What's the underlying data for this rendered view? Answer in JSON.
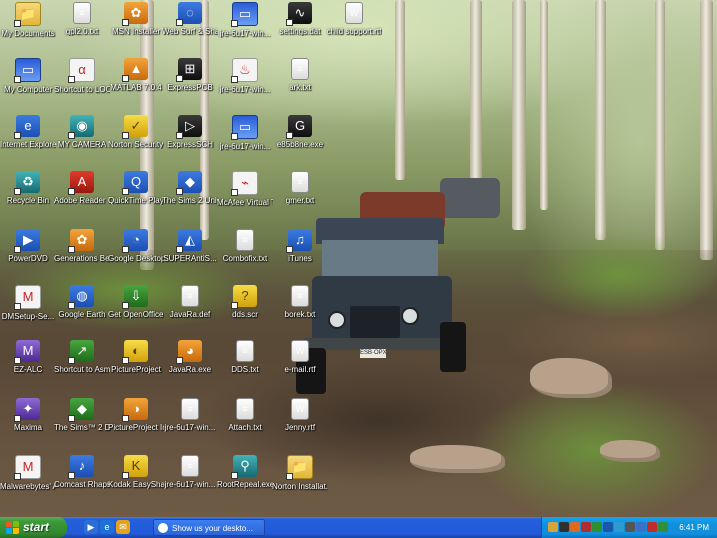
{
  "desktop": {
    "icons": [
      {
        "label": "My Documents",
        "glyph": "📁",
        "cls": "g-folder",
        "col": 0,
        "row": 0
      },
      {
        "label": "My Computer",
        "glyph": "▭",
        "cls": "g-win",
        "col": 0,
        "row": 1
      },
      {
        "label": "Internet Explorer",
        "glyph": "e",
        "cls": "g-blue",
        "col": 0,
        "row": 2
      },
      {
        "label": "Recycle Bin",
        "glyph": "♻",
        "cls": "g-teal",
        "col": 0,
        "row": 3
      },
      {
        "label": "PowerDVD",
        "glyph": "▶",
        "cls": "g-blue",
        "col": 0,
        "row": 4
      },
      {
        "label": "DMSetup-Se...",
        "glyph": "M",
        "cls": "g-white",
        "col": 0,
        "row": 5
      },
      {
        "label": "EZ-ALC",
        "glyph": "M",
        "cls": "g-purple",
        "col": 0,
        "row": 6
      },
      {
        "label": "Maxima",
        "glyph": "✦",
        "cls": "g-purple",
        "col": 0,
        "row": 7
      },
      {
        "label": "Malwarebytes' Anti-Malware",
        "glyph": "M",
        "cls": "g-white",
        "col": 0,
        "row": 8
      },
      {
        "label": "gpl2.0.txt",
        "glyph": "≡",
        "cls": "g-doc",
        "col": 1,
        "row": 0
      },
      {
        "label": "Shortcut to LOOK.EXE",
        "glyph": "α",
        "cls": "g-white",
        "col": 1,
        "row": 1
      },
      {
        "label": "MY CAMERA",
        "glyph": "◉",
        "cls": "g-teal",
        "col": 1,
        "row": 2
      },
      {
        "label": "Adobe Reader 7.0",
        "glyph": "A",
        "cls": "g-red",
        "col": 1,
        "row": 3
      },
      {
        "label": "Generations Beginner's...",
        "glyph": "✿",
        "cls": "g-orange",
        "col": 1,
        "row": 4
      },
      {
        "label": "Google Earth",
        "glyph": "◍",
        "cls": "g-blue",
        "col": 1,
        "row": 5
      },
      {
        "label": "Shortcut to AsmIDE",
        "glyph": "↗",
        "cls": "g-green",
        "col": 1,
        "row": 6
      },
      {
        "label": "The Sims™ 2 Deluxe",
        "glyph": "◆",
        "cls": "g-green",
        "col": 1,
        "row": 7
      },
      {
        "label": "Comcast Rhapsody",
        "glyph": "♪",
        "cls": "g-blue",
        "col": 1,
        "row": 8
      },
      {
        "label": "MSN Installer",
        "glyph": "✿",
        "cls": "g-orange",
        "col": 2,
        "row": 0
      },
      {
        "label": "MATLAB 7.0.4",
        "glyph": "▲",
        "cls": "g-orange",
        "col": 2,
        "row": 1
      },
      {
        "label": "Norton Security Scan",
        "glyph": "✓",
        "cls": "g-yellow",
        "col": 2,
        "row": 2
      },
      {
        "label": "QuickTime Player",
        "glyph": "Q",
        "cls": "g-blue",
        "col": 2,
        "row": 3
      },
      {
        "label": "Google Desktop",
        "glyph": "◔",
        "cls": "g-blue",
        "col": 2,
        "row": 4
      },
      {
        "label": "Get OpenOffice...",
        "glyph": "⇩",
        "cls": "g-green",
        "col": 2,
        "row": 5
      },
      {
        "label": "PictureProject",
        "glyph": "◐",
        "cls": "g-yellow",
        "col": 2,
        "row": 6
      },
      {
        "label": "PictureProject In Touch",
        "glyph": "◑",
        "cls": "g-orange",
        "col": 2,
        "row": 7
      },
      {
        "label": "Kodak EasyShare",
        "glyph": "K",
        "cls": "g-yellow",
        "col": 2,
        "row": 8
      },
      {
        "label": "Web Surf & Share Now!",
        "glyph": "◌",
        "cls": "g-blue",
        "col": 3,
        "row": 0
      },
      {
        "label": "ExpressPCB",
        "glyph": "⊞",
        "cls": "g-black",
        "col": 3,
        "row": 1
      },
      {
        "label": "ExpressSCH",
        "glyph": "▷",
        "cls": "g-black",
        "col": 3,
        "row": 2
      },
      {
        "label": "The Sims 2 University",
        "glyph": "◆",
        "cls": "g-blue",
        "col": 3,
        "row": 3
      },
      {
        "label": "SUPERAntiS...",
        "glyph": "◭",
        "cls": "g-blue",
        "col": 3,
        "row": 4
      },
      {
        "label": "JavaRa.def",
        "glyph": "≡",
        "cls": "g-doc",
        "col": 3,
        "row": 5
      },
      {
        "label": "JavaRa.exe",
        "glyph": "◕",
        "cls": "g-orange",
        "col": 3,
        "row": 6
      },
      {
        "label": "jre-6u17-win...",
        "glyph": "≡",
        "cls": "g-doc",
        "col": 3,
        "row": 7
      },
      {
        "label": "jre-6u17-win...",
        "glyph": "≡",
        "cls": "g-doc",
        "col": 3,
        "row": 8
      },
      {
        "label": "jre-6u17-win...",
        "glyph": "▭",
        "cls": "g-win",
        "col": 4,
        "row": 0
      },
      {
        "label": "jre-6u17-win...",
        "glyph": "♨",
        "cls": "g-white",
        "col": 4,
        "row": 1
      },
      {
        "label": "jre-6u17-win...",
        "glyph": "▭",
        "cls": "g-win",
        "col": 4,
        "row": 2
      },
      {
        "label": "McAfee Virtual Technician",
        "glyph": "⌁",
        "cls": "g-white",
        "col": 4,
        "row": 3
      },
      {
        "label": "Combofix.txt",
        "glyph": "≡",
        "cls": "g-doc",
        "col": 4,
        "row": 4
      },
      {
        "label": "dds.scr",
        "glyph": "?",
        "cls": "g-yellow",
        "col": 4,
        "row": 5
      },
      {
        "label": "DDS.txt",
        "glyph": "≡",
        "cls": "g-doc",
        "col": 4,
        "row": 6
      },
      {
        "label": "Attach.txt",
        "glyph": "≡",
        "cls": "g-doc",
        "col": 4,
        "row": 7
      },
      {
        "label": "RootRepeal.exe",
        "glyph": "⚲",
        "cls": "g-teal",
        "col": 4,
        "row": 8
      },
      {
        "label": "settings.dat",
        "glyph": "∿",
        "cls": "g-black",
        "col": 5,
        "row": 0
      },
      {
        "label": "ark.txt",
        "glyph": "≡",
        "cls": "g-doc",
        "col": 5,
        "row": 1
      },
      {
        "label": "e85b8ne.exe",
        "glyph": "G",
        "cls": "g-black",
        "col": 5,
        "row": 2
      },
      {
        "label": "gmer.txt",
        "glyph": "≡",
        "cls": "g-doc",
        "col": 5,
        "row": 3
      },
      {
        "label": "iTunes",
        "glyph": "♫",
        "cls": "g-blue",
        "col": 5,
        "row": 4
      },
      {
        "label": "borek.txt",
        "glyph": "≡",
        "cls": "g-doc",
        "col": 5,
        "row": 5
      },
      {
        "label": "e-mail.rtf",
        "glyph": "W",
        "cls": "g-doc",
        "col": 5,
        "row": 6
      },
      {
        "label": "Jenny.rtf",
        "glyph": "W",
        "cls": "g-doc",
        "col": 5,
        "row": 7
      },
      {
        "label": "Norton Installat...",
        "glyph": "📁",
        "cls": "g-folder",
        "col": 5,
        "row": 8
      },
      {
        "label": "child support.rtf",
        "glyph": "W",
        "cls": "g-doc",
        "col": 6,
        "row": 0
      }
    ]
  },
  "taskbar": {
    "start_label": "start",
    "quick_launch": [
      {
        "icon": "media-player-icon",
        "glyph": "▶",
        "color": "#2b6fd4"
      },
      {
        "icon": "internet-explorer-icon",
        "glyph": "e",
        "color": "#1f6fd8"
      },
      {
        "icon": "outlook-express-icon",
        "glyph": "✉",
        "color": "#e3a31f"
      }
    ],
    "task_button": "Show us your deskto...",
    "tray_icons": [
      {
        "name": "tray-icon-1",
        "color": "#d8a43a"
      },
      {
        "name": "tray-icon-2",
        "color": "#303030"
      },
      {
        "name": "tray-icon-3",
        "color": "#dd6a1e"
      },
      {
        "name": "tray-icon-4",
        "color": "#b22d2d"
      },
      {
        "name": "tray-icon-5",
        "color": "#2e8f2e"
      },
      {
        "name": "tray-icon-6",
        "color": "#1a57a8"
      },
      {
        "name": "tray-icon-7",
        "color": "#2c9bd0"
      },
      {
        "name": "tray-icon-8",
        "color": "#555555"
      },
      {
        "name": "tray-icon-9",
        "color": "#3c6fc8"
      },
      {
        "name": "tray-icon-10",
        "color": "#c22b2b"
      },
      {
        "name": "tray-icon-11",
        "color": "#2f8f3a"
      }
    ],
    "clock": "6:41 PM"
  }
}
